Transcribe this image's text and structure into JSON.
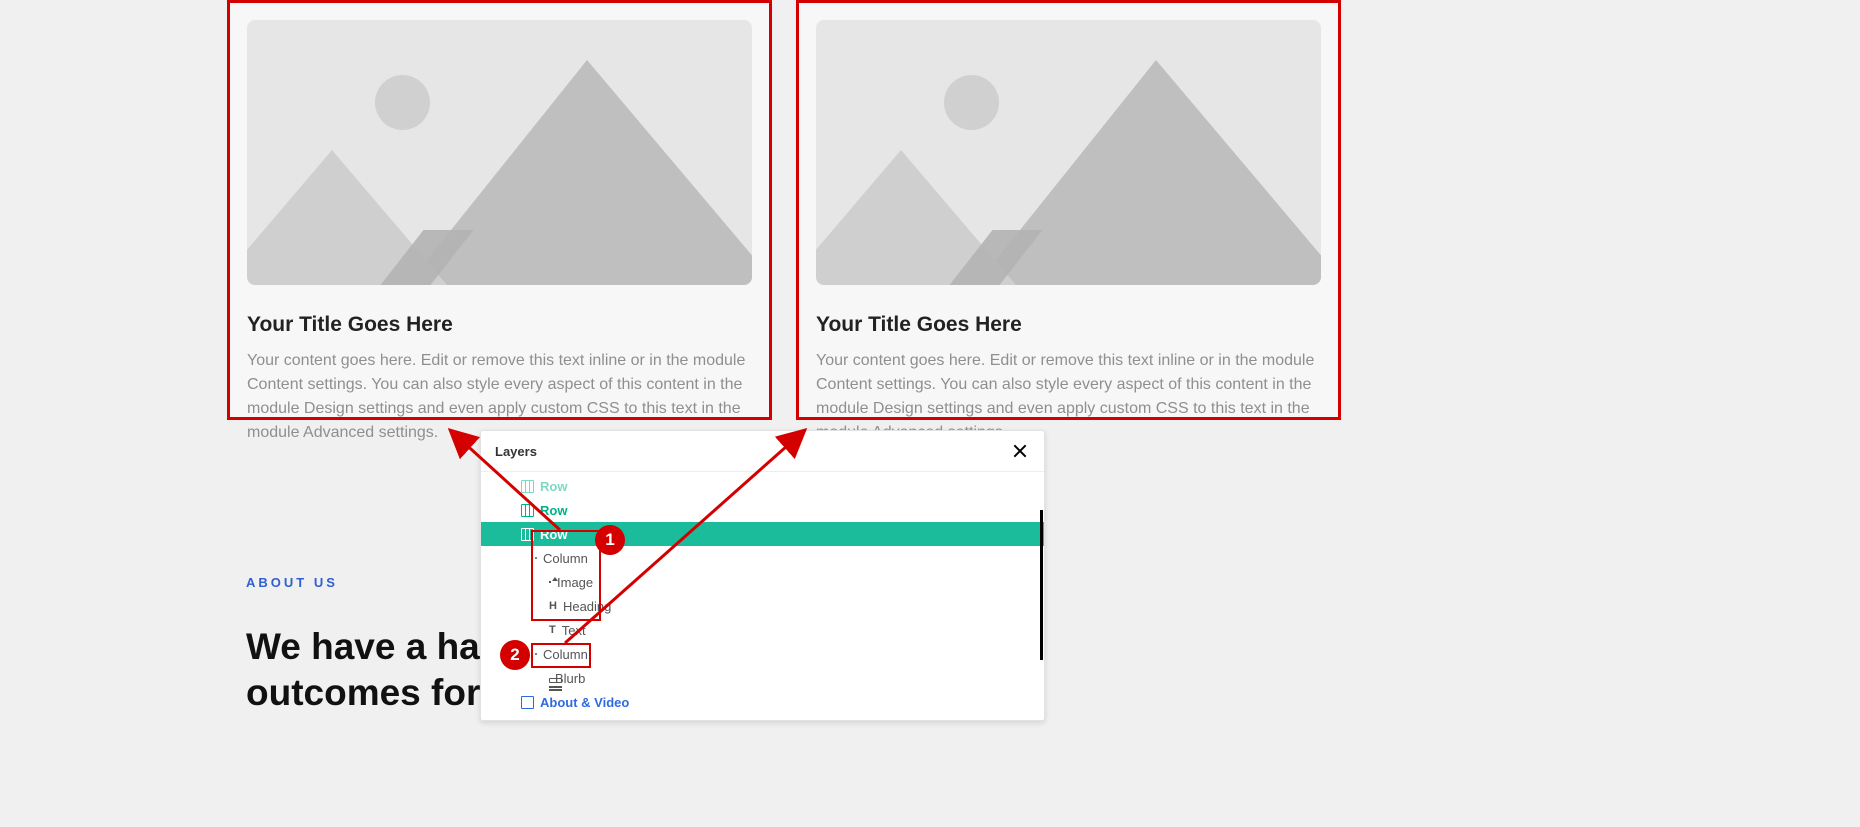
{
  "cards": [
    {
      "title": "Your Title Goes Here",
      "body": "Your content goes here. Edit or remove this text inline or in the module Content settings. You can also style every aspect of this content in the module Design settings and even apply custom CSS to this text in the module Advanced settings."
    },
    {
      "title": "Your Title Goes Here",
      "body": "Your content goes here. Edit or remove this text inline or in the module Content settings. You can also style every aspect of this content in the module Design settings and even apply custom CSS to this text in the module Advanced settings."
    }
  ],
  "about": {
    "label": "ABOUT US",
    "heading_line1": "We have a habit",
    "heading_line2": "outcomes for bu"
  },
  "layers_panel": {
    "header": "Layers",
    "items": {
      "row_trunc": "Row",
      "row_a": "Row",
      "row_b_selected": "Row",
      "column1": "Column",
      "image": "Image",
      "heading": "Heading",
      "text": "Text",
      "column2": "Column",
      "blurb": "Blurb",
      "section_about": "About & Video"
    }
  },
  "annotations": {
    "badge1": "1",
    "badge2": "2"
  }
}
